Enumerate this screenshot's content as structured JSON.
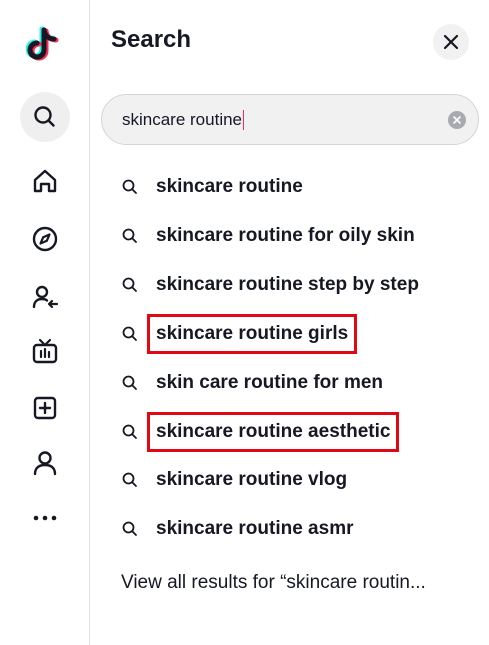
{
  "sidebar": {
    "items": [
      {
        "name": "search-icon"
      },
      {
        "name": "home-icon"
      },
      {
        "name": "explore-icon"
      },
      {
        "name": "following-icon"
      },
      {
        "name": "live-icon"
      },
      {
        "name": "upload-icon"
      },
      {
        "name": "profile-icon"
      },
      {
        "name": "more-icon"
      }
    ],
    "active_item": "search"
  },
  "panel": {
    "title": "Search",
    "close_icon": "close-icon"
  },
  "search": {
    "value": "skincare routine",
    "clear_icon": "clear-icon"
  },
  "suggestions": [
    {
      "text": "skincare routine",
      "highlighted": false
    },
    {
      "text": "skincare routine for oily skin",
      "highlighted": false
    },
    {
      "text": "skincare routine step by step",
      "highlighted": false
    },
    {
      "text": "skincare routine girls",
      "highlighted": true
    },
    {
      "text": "skin care routine for men",
      "highlighted": false
    },
    {
      "text": "skincare routine aesthetic",
      "highlighted": true
    },
    {
      "text": "skincare routine vlog",
      "highlighted": false
    },
    {
      "text": "skincare routine asmr",
      "highlighted": false
    }
  ],
  "view_all": "View all results for “skincare routin...",
  "colors": {
    "accent": "#fe2c55",
    "highlight_border": "#e30613",
    "text": "#161823"
  }
}
